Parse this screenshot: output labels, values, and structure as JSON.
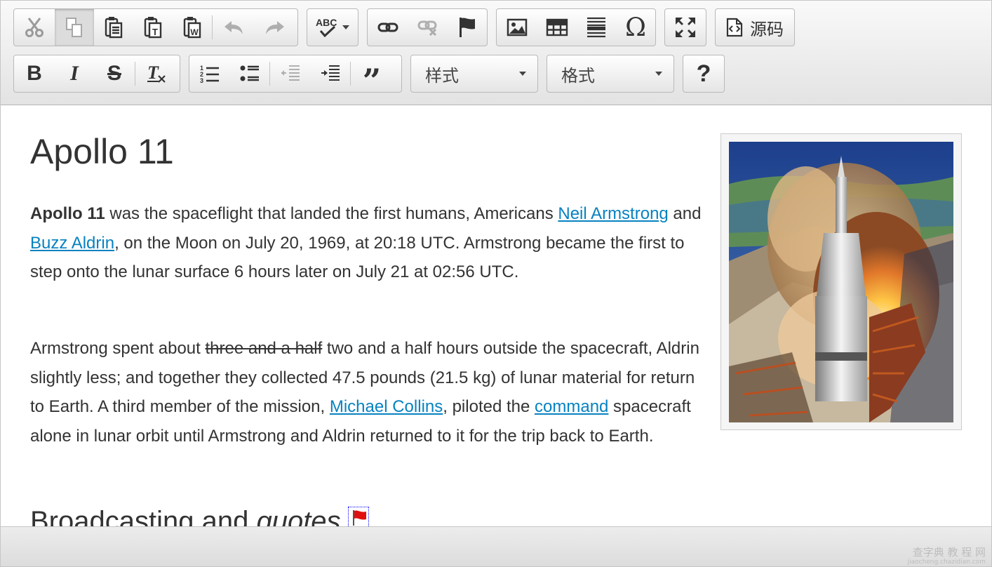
{
  "toolbar": {
    "row1": {
      "clipboard": [
        "cut-icon",
        "copy-icon",
        "paste-icon",
        "paste-text-icon",
        "paste-word-icon",
        "undo-icon",
        "redo-icon"
      ],
      "spellcheck_label": "ABC",
      "links": [
        "link-icon",
        "unlink-icon",
        "anchor-flag-icon"
      ],
      "insert": [
        "image-icon",
        "table-icon",
        "horizontal-rule-icon",
        "special-char-icon"
      ],
      "maximize": "maximize-icon",
      "source_label": "源码"
    },
    "row2": {
      "basic": [
        "bold-icon",
        "italic-icon",
        "strikethrough-icon",
        "remove-format-icon"
      ],
      "list": [
        "numbered-list-icon",
        "bulleted-list-icon",
        "outdent-icon",
        "indent-icon",
        "blockquote-icon"
      ],
      "styles_label": "样式",
      "format_label": "格式",
      "help_label": "?"
    }
  },
  "content": {
    "title": "Apollo 11",
    "p1": {
      "bold": "Apollo 11",
      "t1": " was the spaceflight that landed the first humans, Americans ",
      "link1": "Neil Armstrong",
      "t2": " and ",
      "link2": "Buzz Aldrin",
      "t3": ", on the Moon on July 20, 1969, at 20:18 UTC. Armstrong became the first to step onto the lunar surface 6 hours later on July 21 at 02:56 UTC."
    },
    "p2": {
      "t1": "Armstrong spent about ",
      "strike": "three and a half",
      "t2": " two and a half hours outside the spacecraft, Aldrin slightly less; and together they collected 47.5 pounds (21.5 kg) of lunar material for return to Earth. A third member of the mission, ",
      "link1": "Michael Collins",
      "t3": ", piloted the ",
      "link2": "command",
      "t4": " spacecraft alone in lunar orbit until Armstrong and Aldrin returned to it for the trip back to Earth."
    },
    "h2": {
      "t1": "Broadcasting and ",
      "italic": "quotes"
    },
    "figure_icon": "rocket-launch-photo"
  },
  "watermark": {
    "main": "查字典 教 程 网",
    "sub": "jiaocheng.chazidian.com"
  },
  "colors": {
    "link": "#0782c1",
    "text": "#333333",
    "toolbar_bg": "#e8e8e8"
  }
}
